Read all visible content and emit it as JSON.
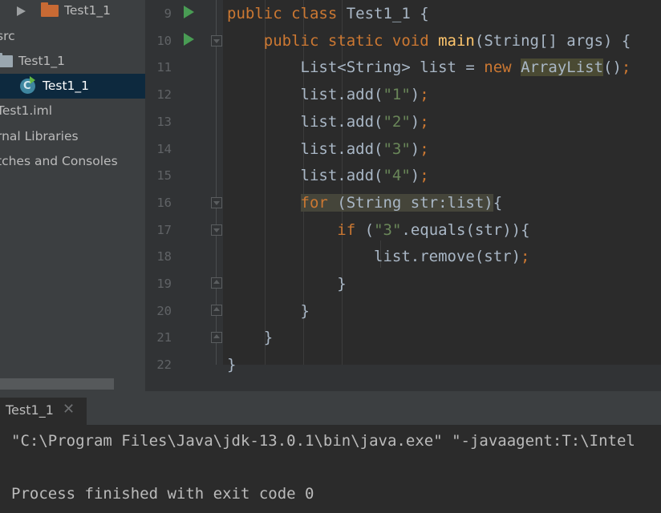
{
  "project_tree": {
    "items": [
      {
        "label": "Test1_1"
      },
      {
        "label": "src"
      },
      {
        "label": "Test1_1"
      },
      {
        "label": "Test1_1"
      },
      {
        "label": "Test1.iml"
      },
      {
        "label": "rnal Libraries"
      },
      {
        "label": "tches and Consoles"
      }
    ]
  },
  "editor": {
    "line_numbers": [
      "9",
      "10",
      "11",
      "12",
      "13",
      "14",
      "15",
      "16",
      "17",
      "18",
      "19",
      "20",
      "21",
      "22"
    ],
    "lines": [
      {
        "parts": [
          {
            "t": "public class ",
            "c": "kw"
          },
          {
            "t": "Test1_1 {",
            "c": ""
          }
        ]
      },
      {
        "parts": [
          {
            "t": "    public static void ",
            "c": "kw"
          },
          {
            "t": "main",
            "c": "fn"
          },
          {
            "t": "(String[] args) {",
            "c": ""
          }
        ]
      },
      {
        "parts": [
          {
            "t": "        List<String> list = ",
            "c": ""
          },
          {
            "t": "new ",
            "c": "kw"
          },
          {
            "t": "ArrayList",
            "c": "hl"
          },
          {
            "t": "()",
            "c": ""
          },
          {
            "t": ";",
            "c": "kw"
          }
        ]
      },
      {
        "parts": [
          {
            "t": "        list.add(",
            "c": ""
          },
          {
            "t": "\"1\"",
            "c": "str"
          },
          {
            "t": ")",
            "c": ""
          },
          {
            "t": ";",
            "c": "kw"
          }
        ]
      },
      {
        "parts": [
          {
            "t": "        list.add(",
            "c": ""
          },
          {
            "t": "\"2\"",
            "c": "str"
          },
          {
            "t": ")",
            "c": ""
          },
          {
            "t": ";",
            "c": "kw"
          }
        ]
      },
      {
        "parts": [
          {
            "t": "        list.add(",
            "c": ""
          },
          {
            "t": "\"3\"",
            "c": "str"
          },
          {
            "t": ")",
            "c": ""
          },
          {
            "t": ";",
            "c": "kw"
          }
        ]
      },
      {
        "parts": [
          {
            "t": "        list.add(",
            "c": ""
          },
          {
            "t": "\"4\"",
            "c": "str"
          },
          {
            "t": ")",
            "c": ""
          },
          {
            "t": ";",
            "c": "kw"
          }
        ]
      },
      {
        "parts": [
          {
            "t": "        ",
            "c": ""
          },
          {
            "t": "for ",
            "c": "kw hl2"
          },
          {
            "t": "(String str:list)",
            "c": "hl2"
          },
          {
            "t": "{",
            "c": ""
          }
        ]
      },
      {
        "parts": [
          {
            "t": "            ",
            "c": ""
          },
          {
            "t": "if ",
            "c": "kw"
          },
          {
            "t": "(",
            "c": ""
          },
          {
            "t": "\"3\"",
            "c": "str"
          },
          {
            "t": ".equals(str)){",
            "c": ""
          }
        ]
      },
      {
        "parts": [
          {
            "t": "                list.remove(str)",
            "c": ""
          },
          {
            "t": ";",
            "c": "kw"
          }
        ]
      },
      {
        "parts": [
          {
            "t": "            }",
            "c": ""
          }
        ]
      },
      {
        "parts": [
          {
            "t": "        }",
            "c": ""
          }
        ]
      },
      {
        "parts": [
          {
            "t": "    }",
            "c": ""
          }
        ]
      },
      {
        "parts": [
          {
            "t": "}",
            "c": ""
          }
        ]
      }
    ]
  },
  "run_panel": {
    "tab_label": "Test1_1",
    "close_glyph": "✕",
    "console_lines": [
      "\"C:\\Program Files\\Java\\jdk-13.0.1\\bin\\java.exe\" \"-javaagent:T:\\Intel",
      "",
      "Process finished with exit code 0"
    ]
  },
  "colors": {
    "keyword": "#cc7832",
    "method": "#ffc66d",
    "string": "#6a8759",
    "text": "#a9b7c6",
    "selection": "#0d293e"
  }
}
